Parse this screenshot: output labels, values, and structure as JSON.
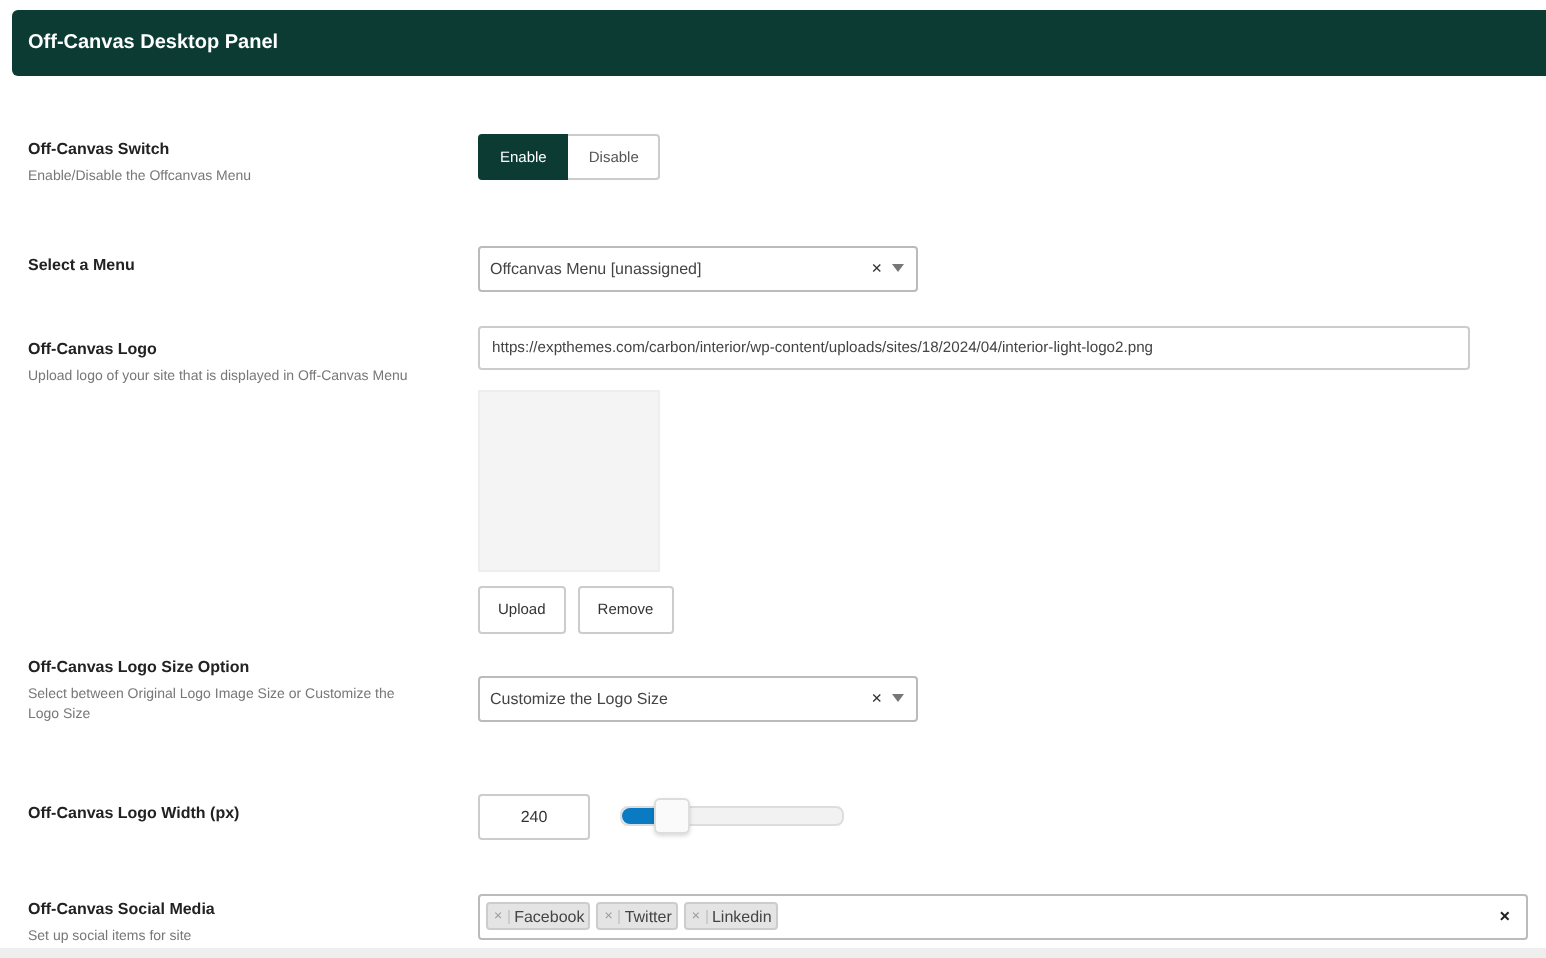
{
  "panel": {
    "title": "Off-Canvas Desktop Panel"
  },
  "fields": [
    {
      "kind": "toggle",
      "label": "Off-Canvas Switch",
      "description": "Enable/Disable the Offcanvas Menu",
      "options": [
        {
          "label": "Enable",
          "selected": true
        },
        {
          "label": "Disable",
          "selected": false
        }
      ]
    },
    {
      "kind": "select",
      "label": "Select a Menu",
      "value": "Offcanvas Menu [unassigned]",
      "clear": "×"
    },
    {
      "kind": "upload",
      "label": "Off-Canvas Logo",
      "description": "Upload logo of your site that is displayed in Off-Canvas Menu",
      "value": "https://expthemes.com/carbon/interior/wp-content/uploads/sites/18/2024/04/interior-light-logo2.png",
      "buttons": [
        "Upload",
        "Remove"
      ]
    },
    {
      "kind": "select",
      "label": "Off-Canvas Logo Size Option",
      "description": "Select between Original Logo Image Size or Customize the Logo Size",
      "value": "Customize the Logo Size",
      "clear": "×"
    },
    {
      "kind": "range",
      "label": "Off-Canvas Logo Width (px)",
      "value": "240",
      "level": 0.24
    },
    {
      "kind": "tags",
      "label": "Off-Canvas Social Media",
      "description": "Set up social items for site",
      "tags": [
        {
          "remove": "×",
          "label": "Facebook"
        },
        {
          "remove": "×",
          "label": "Twitter"
        },
        {
          "remove": "×",
          "label": "Linkedin"
        }
      ],
      "clear": "×"
    }
  ]
}
